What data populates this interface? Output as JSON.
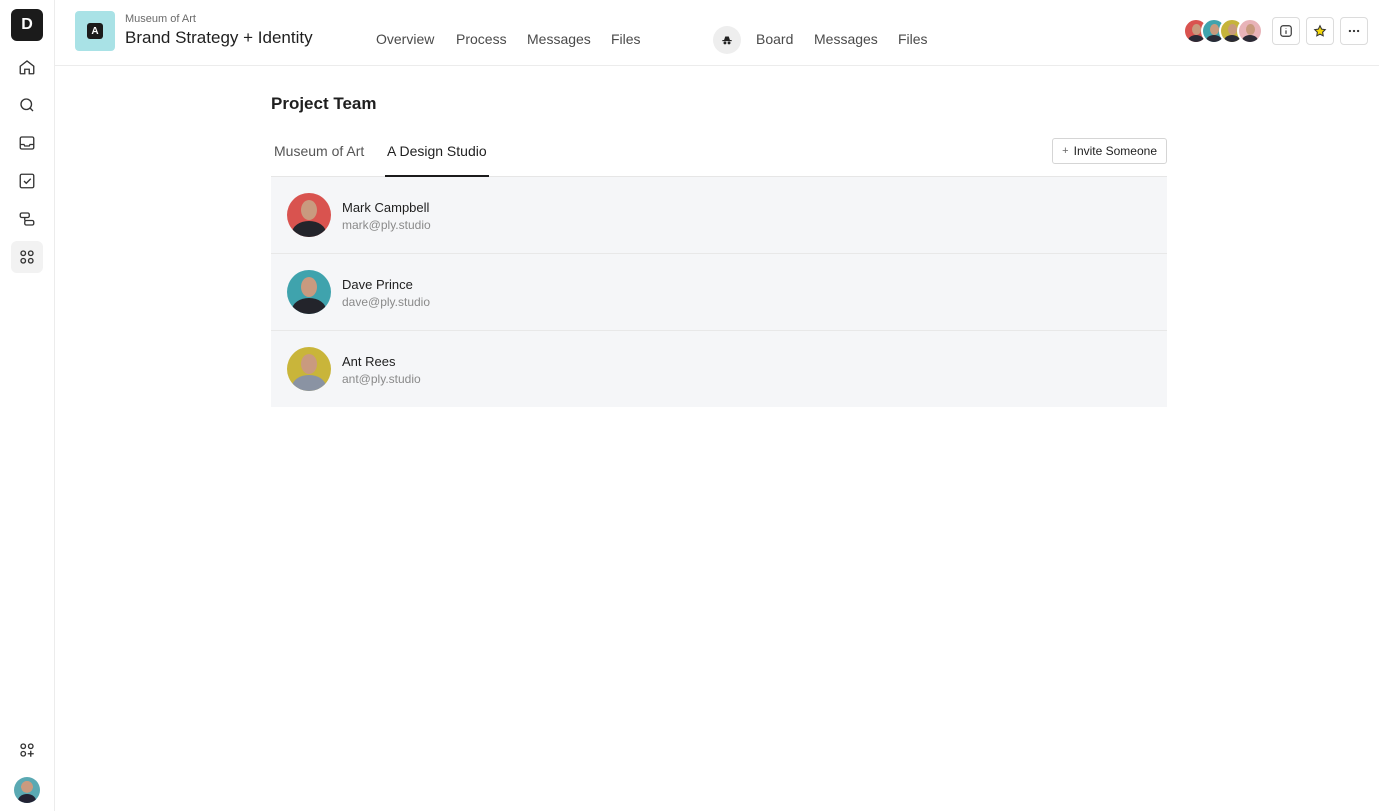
{
  "app": {
    "logo_letter": "D"
  },
  "sidebar": {
    "items": [
      {
        "icon": "home-icon"
      },
      {
        "icon": "search-icon"
      },
      {
        "icon": "inbox-icon"
      },
      {
        "icon": "tasks-icon"
      },
      {
        "icon": "workflow-icon"
      },
      {
        "icon": "apps-grid-icon",
        "active": true
      }
    ],
    "bottom": [
      {
        "icon": "add-app-icon"
      },
      {
        "icon": "user-avatar"
      }
    ]
  },
  "header": {
    "badge_letter": "A",
    "client": "Museum of Art",
    "project": "Brand Strategy + Identity",
    "client_nav": [
      "Overview",
      "Process",
      "Messages",
      "Files"
    ],
    "team_nav": [
      "Board",
      "Messages",
      "Files"
    ],
    "avatar_colors": [
      "#d9534f",
      "#3fa3ad",
      "#c6b43a",
      "#e8b3b8"
    ]
  },
  "main": {
    "title": "Project Team",
    "tabs": [
      {
        "label": "Museum of Art",
        "active": false
      },
      {
        "label": "A Design Studio",
        "active": true
      }
    ],
    "invite_label": "Invite Someone",
    "members": [
      {
        "name": "Mark Campbell",
        "email": "mark@ply.studio",
        "color": "#d9534f"
      },
      {
        "name": "Dave Prince",
        "email": "dave@ply.studio",
        "color": "#3fa3ad"
      },
      {
        "name": "Ant Rees",
        "email": "ant@ply.studio",
        "color": "#c9b53a"
      }
    ]
  }
}
